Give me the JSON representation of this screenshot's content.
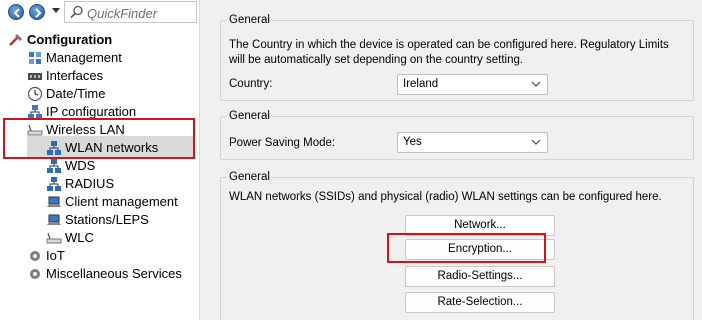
{
  "toolbar": {
    "back_icon": "back-arrow-icon",
    "forward_icon": "forward-arrow-icon",
    "dropdown_icon": "chevron-down-icon",
    "search_icon": "magnifier-icon",
    "quickfinder_placeholder": "QuickFinder"
  },
  "tree": {
    "root": "Configuration",
    "items": [
      {
        "label": "Management",
        "icon": "management-icon"
      },
      {
        "label": "Interfaces",
        "icon": "interfaces-icon"
      },
      {
        "label": "Date/Time",
        "icon": "clock-icon"
      },
      {
        "label": "IP configuration",
        "icon": "network-icon"
      },
      {
        "label": "Wireless LAN",
        "icon": "wireless-icon"
      },
      {
        "label": "WLAN networks",
        "icon": "network-icon"
      },
      {
        "label": "WDS",
        "icon": "network-icon"
      },
      {
        "label": "RADIUS",
        "icon": "network-icon"
      },
      {
        "label": "Client management",
        "icon": "laptop-icon"
      },
      {
        "label": "Stations/LEPS",
        "icon": "laptop-icon"
      },
      {
        "label": "WLC",
        "icon": "wireless-icon"
      },
      {
        "label": "IoT",
        "icon": "gear-icon"
      },
      {
        "label": "Miscellaneous Services",
        "icon": "gear-icon"
      }
    ]
  },
  "groups": {
    "country": {
      "title": "General",
      "description": "The Country in which the device is operated can be configured here. Regulatory Limits will be automatically set depending on the country setting.",
      "label": "Country:",
      "value": "Ireland"
    },
    "power": {
      "title": "General",
      "label": "Power Saving Mode:",
      "value": "Yes"
    },
    "wlan": {
      "title": "General",
      "description": "WLAN networks (SSIDs) and physical (radio) WLAN settings can be configured here.",
      "buttons": [
        "Network...",
        "Encryption...",
        "Radio-Settings...",
        "Rate-Selection..."
      ]
    }
  },
  "colors": {
    "highlight": "#d0141c",
    "selection": "#d9d9d9",
    "panel": "#f0f0f0"
  }
}
